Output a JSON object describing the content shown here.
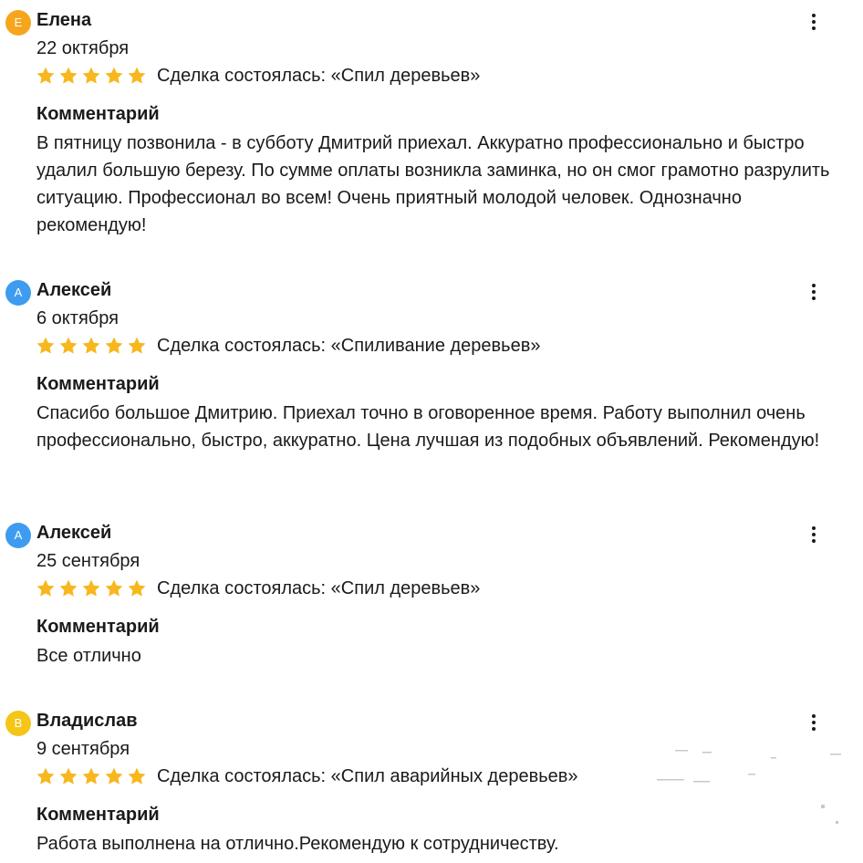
{
  "colors": {
    "star": "#f7b71d",
    "avatar_orange": "#f7a51d",
    "avatar_blue": "#3d9cf0",
    "avatar_yellow": "#f5c518"
  },
  "icons": {
    "star": "star-icon",
    "menu": "more-vertical-icon"
  },
  "reviews": [
    {
      "avatar_letter": "Е",
      "avatar_color": "#f7a51d",
      "author": "Елена",
      "date": "22 октября",
      "rating": 5,
      "deal": "Сделка состоялась: «Спил деревьев»",
      "comment_title": "Комментарий",
      "comment": "В пятницу позвонила - в субботу Дмитрий приехал. Аккуратно профессионально и быстро удалил большую березу. По сумме оплаты возникла заминка, но он смог грамотно разрулить ситуацию. Профессионал во всем! Очень приятный молодой человек. Однозначно рекомендую!"
    },
    {
      "avatar_letter": "А",
      "avatar_color": "#3d9cf0",
      "author": "Алексей",
      "date": "6 октября",
      "rating": 5,
      "deal": "Сделка состоялась: «Спиливание деревьев»",
      "comment_title": "Комментарий",
      "comment": "Спасибо большое Дмитрию. Приехал точно в оговоренное время. Работу выполнил очень профессионально, быстро, аккуратно. Цена лучшая из подобных объявлений. Рекомендую!"
    },
    {
      "avatar_letter": "А",
      "avatar_color": "#3d9cf0",
      "author": "Алексей",
      "date": "25 сентября",
      "rating": 5,
      "deal": "Сделка состоялась: «Спил деревьев»",
      "comment_title": "Комментарий",
      "comment": "Все отлично"
    },
    {
      "avatar_letter": "В",
      "avatar_color": "#f5c518",
      "author": "Владислав",
      "date": "9 сентября",
      "rating": 5,
      "deal": "Сделка состоялась: «Спил аварийных деревьев»",
      "comment_title": "Комментарий",
      "comment": "Работа выполнена на отлично.Рекомендую к сотрудничеству."
    }
  ]
}
